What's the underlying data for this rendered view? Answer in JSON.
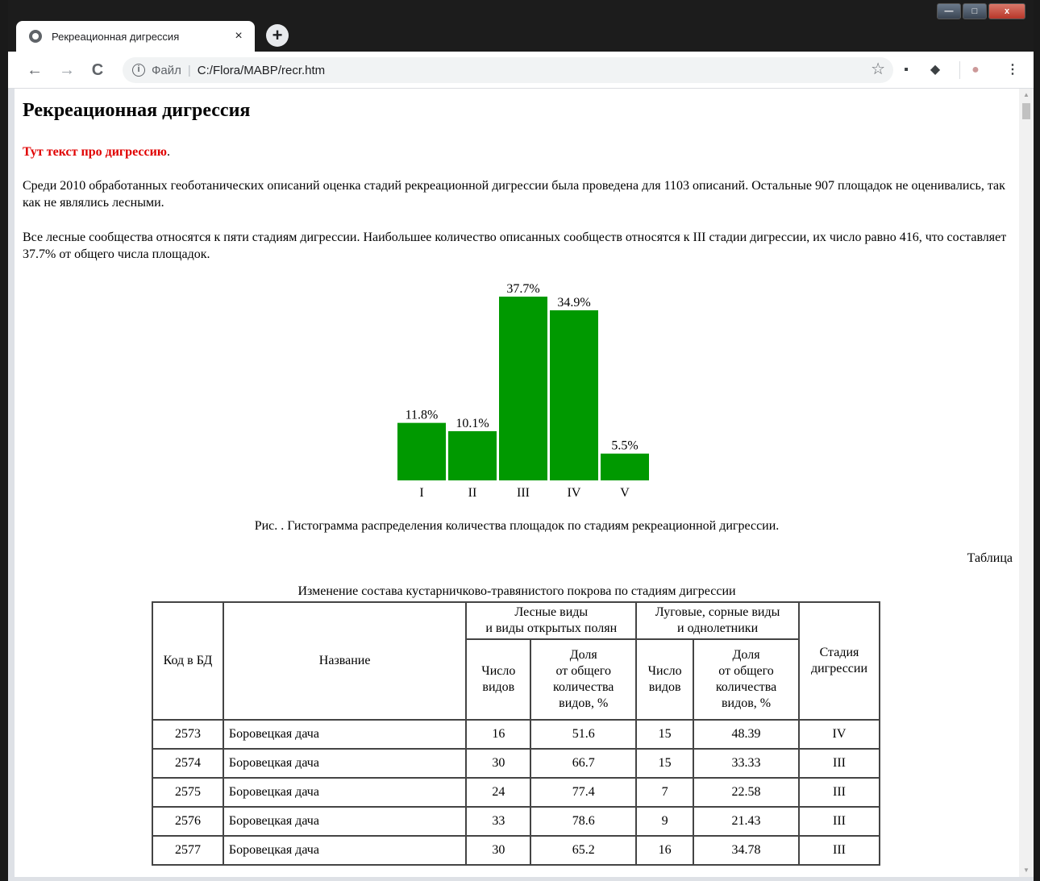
{
  "browser": {
    "tab_title": "Рекреационная дигрессия",
    "tab_close": "×",
    "new_tab": "+",
    "scheme": "Файл",
    "url": "C:/Flora/MABP/recr.htm",
    "win_minimize": "—",
    "win_maximize": "□",
    "win_close": "x",
    "back": "←",
    "forward": "→",
    "reload": "C",
    "star": "☆",
    "menu": "⋮"
  },
  "page": {
    "heading": "Рекреационная дигрессия",
    "red_text": "Тут текст про дигрессию",
    "red_text_suffix": ".",
    "para1": "Среди 2010 обработанных геоботанических описаний оценка стадий рекреационной дигрессии была проведена для 1103 описаний. Остальные 907 площадок не оценивались, так как не являлись лесными.",
    "para2": "Все лесные сообщества относятся к пяти стадиям дигрессии. Наибольшее количество описанных сообществ относятся к III стадии дигрессии, их число равно 416, что составляет 37.7% от общего числа площадок.",
    "figure_caption": "Рис. . Гистограмма распределения количества площадок по стадиям рекреационной дигрессии.",
    "table_label": "Таблица",
    "table_title": "Изменение состава кустарничково-травянистого покрова по стадиям дигрессии"
  },
  "chart_data": {
    "type": "bar",
    "categories": [
      "I",
      "II",
      "III",
      "IV",
      "V"
    ],
    "values": [
      11.8,
      10.1,
      37.7,
      34.9,
      5.5
    ],
    "value_labels": [
      "11.8%",
      "10.1%",
      "37.7%",
      "34.9%",
      "5.5%"
    ],
    "title": "",
    "xlabel": "",
    "ylabel": "",
    "ylim": [
      0,
      37.7
    ],
    "bar_color": "#009900",
    "grid": false
  },
  "table": {
    "headers": {
      "code": "Код в БД",
      "name": "Название",
      "forest_group": "Лесные виды\nи виды открытых полян",
      "meadow_group": "Луговые, сорные виды\nи однолетники",
      "count": "Число\nвидов",
      "share": "Доля\nот общего\nколичества\nвидов, %",
      "stage": "Стадия\nдигрессии"
    },
    "rows": [
      [
        "2573",
        "Боровецкая дача",
        "16",
        "51.6",
        "15",
        "48.39",
        "IV"
      ],
      [
        "2574",
        "Боровецкая дача",
        "30",
        "66.7",
        "15",
        "33.33",
        "III"
      ],
      [
        "2575",
        "Боровецкая дача",
        "24",
        "77.4",
        "7",
        "22.58",
        "III"
      ],
      [
        "2576",
        "Боровецкая дача",
        "33",
        "78.6",
        "9",
        "21.43",
        "III"
      ],
      [
        "2577",
        "Боровецкая дача",
        "30",
        "65.2",
        "16",
        "34.78",
        "III"
      ]
    ]
  }
}
